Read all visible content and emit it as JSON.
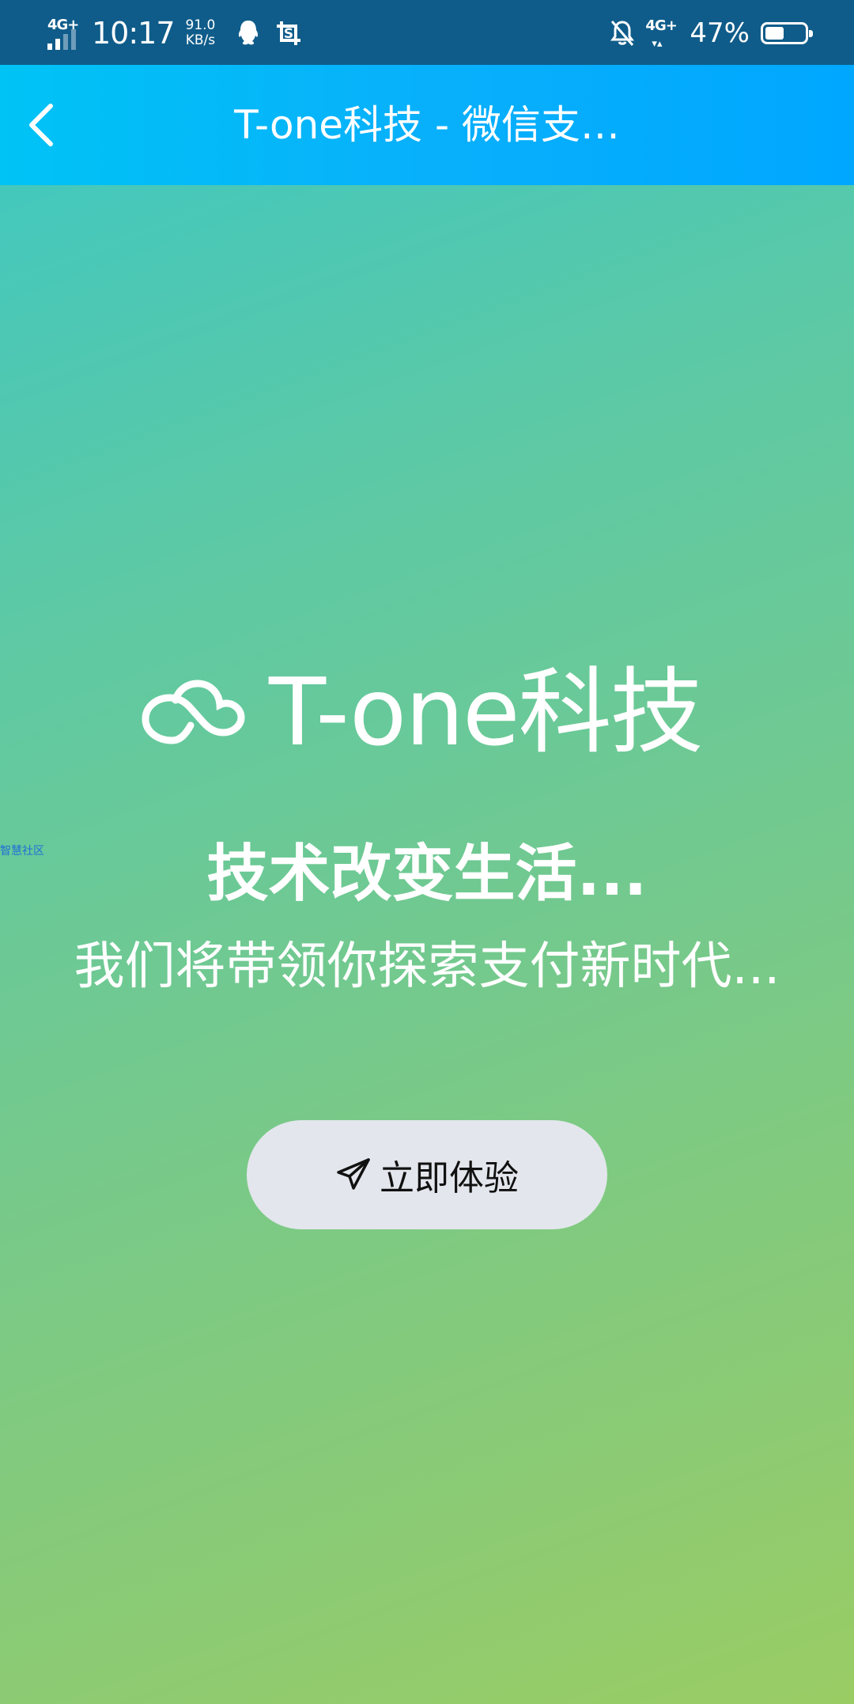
{
  "status_bar": {
    "signal_type": "4G+",
    "time": "10:17",
    "net_speed_value": "91.0",
    "net_speed_unit": "KB/s",
    "network_type_right": "4G+",
    "battery_percent": "47%",
    "battery_level": 0.47
  },
  "nav": {
    "title": "T-one科技 - 微信支…"
  },
  "edge_text": "智慧社区",
  "hero": {
    "brand_name": "T-one科技",
    "slogan": "技术改变生活...",
    "sub_slogan": "我们将带领你探索支付新时代...",
    "cta_label": "立即体验"
  },
  "colors": {
    "status_bar_bg": "#0f5c8a",
    "nav_gradient_start": "#00c3f5",
    "nav_gradient_end": "#00a7ff",
    "bg_gradient_start": "#39c7c7",
    "bg_gradient_end": "#9acc64",
    "button_bg": "#e3e6ec"
  },
  "icons": {
    "back": "chevron-left-icon",
    "logo": "cloud-icon",
    "button": "send-icon",
    "status_left": [
      "qq-icon",
      "screenshot-s-icon"
    ],
    "status_right": [
      "bell-off-icon",
      "battery-icon"
    ]
  }
}
